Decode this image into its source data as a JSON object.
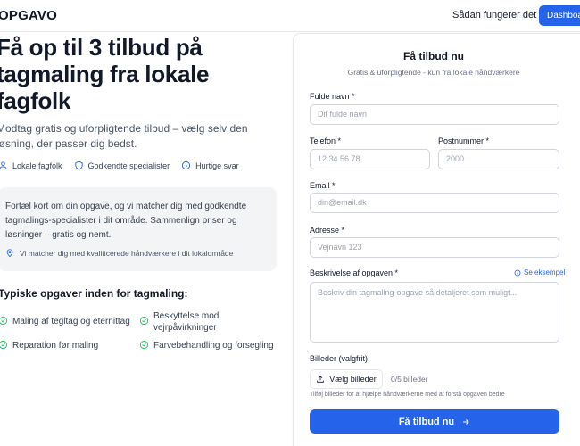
{
  "header": {
    "logo": "OPGAVO",
    "nav_link": "Sådan fungerer det",
    "dashboard_button": "Dashboard"
  },
  "hero": {
    "title": "Få op til 3 tilbud på tagmaling fra lokale fagfolk",
    "subtitle": "Modtag gratis og uforpligtende tilbud – vælg selv den løsning, der passer dig bedst.",
    "features": [
      {
        "icon": "user-icon",
        "label": "Lokale fagfolk"
      },
      {
        "icon": "shield-icon",
        "label": "Godkendte specialister"
      },
      {
        "icon": "clock-icon",
        "label": "Hurtige svar"
      }
    ]
  },
  "info": {
    "text": "Fortæl kort om din opgave, og vi matcher dig med godkendte tagmalings-specialister i dit område. Sammenlign priser og løsninger – gratis og nemt.",
    "location_note": "Vi matcher dig med kvalificerede håndværkere i dit lokalområde"
  },
  "tasks": {
    "title": "Typiske opgaver inden for tagmaling:",
    "items": [
      "Maling af tegltag og eternittag",
      "Beskyttelse mod vejrpåvirkninger",
      "Reparation før maling",
      "Farvebehandling og forsegling"
    ]
  },
  "form": {
    "title": "Få tilbud nu",
    "subtitle": "Gratis & uforpligtende - kun fra lokale håndværkere",
    "name": {
      "label": "Fulde navn *",
      "placeholder": "Dit fulde navn"
    },
    "phone": {
      "label": "Telefon *",
      "placeholder": "12 34 56 78"
    },
    "postal": {
      "label": "Postnummer *",
      "placeholder": "2000"
    },
    "email": {
      "label": "Email *",
      "placeholder": "din@email.dk"
    },
    "address": {
      "label": "Adresse *",
      "placeholder": "Vejnavn 123"
    },
    "description": {
      "label": "Beskrivelse af opgaven *",
      "example_link": "Se eksempel",
      "placeholder": "Beskriv din tagmaling-opgave så detaljeret som muligt..."
    },
    "images": {
      "label": "Billeder (valgfrit)",
      "button": "Vælg billeder",
      "count": "0/5 billeder",
      "hint": "Tilføj billeder for at hjælpe håndværkerne med at forstå opgaven bedre"
    },
    "submit": "Få tilbud nu"
  },
  "colors": {
    "accent": "#2563eb",
    "check": "#22c55e"
  }
}
